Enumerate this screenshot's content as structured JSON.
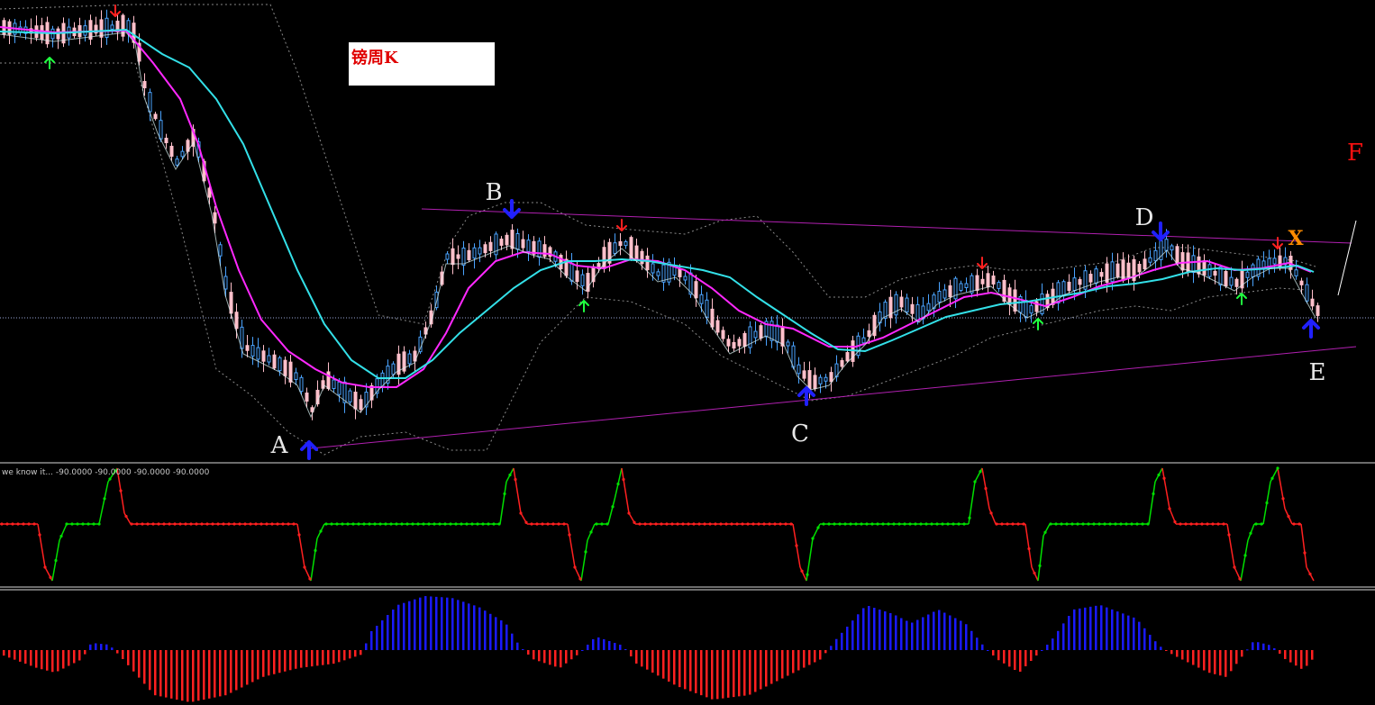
{
  "title": "镑周K",
  "indicator_label": "we know it...  -90.0000 -90.0000 -90.0000 -90.0000",
  "colors": {
    "background": "#000000",
    "bull_candle": "#4aa3ff",
    "bear_candle": "#ffc0cb",
    "ma_fast": "#ff28ff",
    "ma_slow": "#33e0e8",
    "trendline": "#b020b0",
    "band": "#8a8a8a",
    "osc_up": "#00e000",
    "osc_down": "#ff2020",
    "hist_pos": "#1a1aff",
    "hist_neg": "#ff2020",
    "letter_label": "#e8e8e8",
    "f_label": "#ff1010",
    "x_label": "#ff8c00"
  },
  "chart_data": [
    {
      "type": "candlestick",
      "title": "镑周K",
      "pattern_points": [
        {
          "label": "A",
          "color": "#e8e8e8"
        },
        {
          "label": "B",
          "color": "#e8e8e8"
        },
        {
          "label": "C",
          "color": "#e8e8e8"
        },
        {
          "label": "D",
          "color": "#e8e8e8"
        },
        {
          "label": "E",
          "color": "#e8e8e8"
        },
        {
          "label": "F",
          "color": "#ff1010"
        },
        {
          "label": "X",
          "color": "#ff8c00"
        }
      ],
      "signal_arrows": [
        {
          "direction": "down",
          "color": "red"
        },
        {
          "direction": "up",
          "color": "green"
        },
        {
          "direction": "up",
          "color": "blue"
        },
        {
          "direction": "down",
          "color": "blue"
        },
        {
          "direction": "down",
          "color": "red"
        },
        {
          "direction": "up",
          "color": "green"
        },
        {
          "direction": "up",
          "color": "blue"
        },
        {
          "direction": "down",
          "color": "red"
        },
        {
          "direction": "up",
          "color": "green"
        },
        {
          "direction": "down",
          "color": "blue"
        },
        {
          "direction": "up",
          "color": "green"
        },
        {
          "direction": "down",
          "color": "red"
        },
        {
          "direction": "up",
          "color": "blue"
        }
      ]
    },
    {
      "type": "line",
      "name": "we know it...",
      "values_printed": [
        -90.0,
        -90.0,
        -90.0,
        -90.0
      ]
    },
    {
      "type": "histogram"
    }
  ]
}
